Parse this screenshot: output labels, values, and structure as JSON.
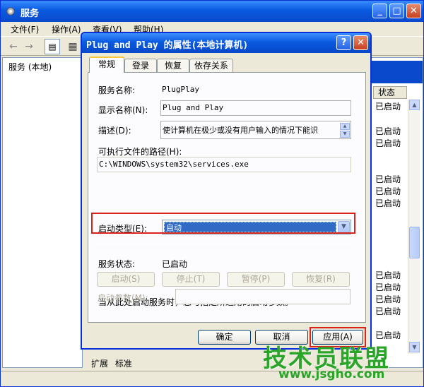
{
  "services_window": {
    "title": "服务",
    "menu": [
      "文件(F)",
      "操作(A)",
      "查看(V)",
      "帮助(H)"
    ],
    "tree_node": "服务 (本地)",
    "status_column_header": "状态",
    "status_values": [
      "已启动",
      "已启动",
      "已启动",
      "已启动",
      "已启动",
      "已启动",
      "已启动",
      "已启动",
      "已启动",
      "已启动",
      "已启动"
    ],
    "bottom_tabs": [
      "扩展",
      "标准"
    ]
  },
  "dialog": {
    "title": "Plug and Play 的属性(本地计算机)",
    "help_glyph": "?",
    "close_glyph": "✕",
    "tabs": [
      "常规",
      "登录",
      "恢复",
      "依存关系"
    ],
    "service_name_label": "服务名称:",
    "service_name_value": "PlugPlay",
    "display_name_label": "显示名称(N):",
    "display_name_value": "Plug and Play",
    "description_label": "描述(D):",
    "description_value": "使计算机在极少或没有用户输入的情况下能识",
    "exe_path_label": "可执行文件的路径(H):",
    "exe_path_value": "C:\\WINDOWS\\system32\\services.exe",
    "startup_type_label": "启动类型(E):",
    "startup_type_value": "自动",
    "service_status_label": "服务状态:",
    "service_status_value": "已启动",
    "start_button": "启动(S)",
    "stop_button": "停止(T)",
    "pause_button": "暂停(P)",
    "resume_button": "恢复(R)",
    "hint_text": "当从此处启动服务时，您可指定所适用的启动参数。",
    "start_params_label": "启动参数(M):",
    "start_params_value": "",
    "ok_button": "确定",
    "cancel_button": "取消",
    "apply_button": "应用(A)"
  },
  "watermark": {
    "brand": "技术员联盟",
    "url": "www.jsgho.com"
  },
  "colors": {
    "xp_title_blue": "#0a5ae0",
    "highlight_red": "#d9241c",
    "selection_blue": "#316ac5",
    "watermark_green": "#2aa52a"
  }
}
